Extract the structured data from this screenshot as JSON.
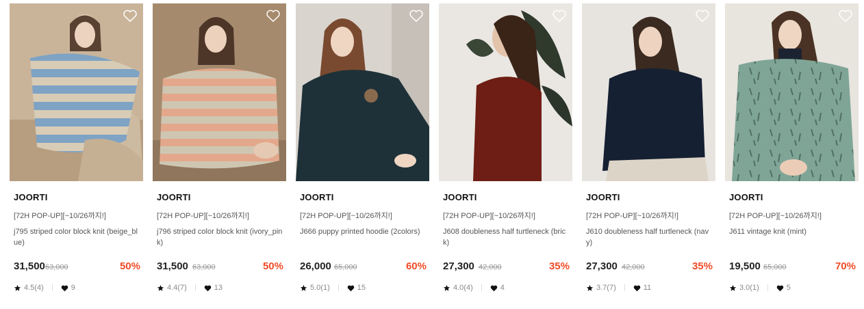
{
  "products": [
    {
      "brand": "JOORTI",
      "promo": "[72H POP-UP][~10/26까지!]",
      "name": "j795 striped color block knit (beige_blue)",
      "price": "31,500",
      "original_price": "63,000",
      "discount": "50%",
      "rating": "4.5(4)",
      "likes": "9",
      "image": "model-beige-blue-striped-knit"
    },
    {
      "brand": "JOORTI",
      "promo": "[72H POP-UP][~10/26까지!]",
      "name": "j796 striped color block knit (ivory_pink)",
      "price": "31,500",
      "original_price": "63,000",
      "discount": "50%",
      "rating": "4.4(7)",
      "likes": "13",
      "image": "model-ivory-pink-striped-knit"
    },
    {
      "brand": "JOORTI",
      "promo": "[72H POP-UP][~10/26까지!]",
      "name": "J666 puppy printed hoodie (2colors)",
      "price": "26,000",
      "original_price": "65,000",
      "discount": "60%",
      "rating": "5.0(1)",
      "likes": "15",
      "image": "model-navy-puppy-hoodie"
    },
    {
      "brand": "JOORTI",
      "promo": "[72H POP-UP][~10/26까지!]",
      "name": "J608 doubleness half turtleneck (brick)",
      "price": "27,300",
      "original_price": "42,000",
      "discount": "35%",
      "rating": "4.0(4)",
      "likes": "4",
      "image": "model-brick-half-turtleneck"
    },
    {
      "brand": "JOORTI",
      "promo": "[72H POP-UP][~10/26까지!]",
      "name": "J610 doubleness half turtleneck (navy)",
      "price": "27,300",
      "original_price": "42,000",
      "discount": "35%",
      "rating": "3.7(7)",
      "likes": "11",
      "image": "model-navy-half-turtleneck"
    },
    {
      "brand": "JOORTI",
      "promo": "[72H POP-UP][~10/26까지!]",
      "name": "J611 vintage knit (mint)",
      "price": "19,500",
      "original_price": "65,000",
      "discount": "70%",
      "rating": "3.0(1)",
      "likes": "5",
      "image": "model-mint-vintage-knit"
    }
  ],
  "icons": {
    "wishlist": "heart-outline-icon",
    "rating": "star-icon",
    "likes": "heart-filled-icon"
  },
  "colors": {
    "discount": "#ef4b26",
    "original_price": "#999999",
    "text": "#222222"
  }
}
